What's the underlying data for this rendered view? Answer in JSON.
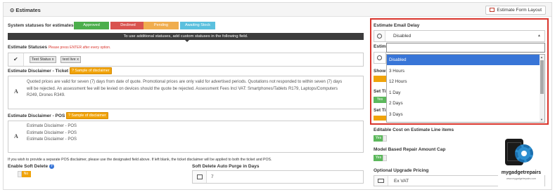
{
  "panel": {
    "title": "Estimates",
    "layout_button": "Estimate Form Layout"
  },
  "system_statuses": {
    "label": "System statuses for estimates:",
    "items": [
      {
        "label": "Approved",
        "color": "#5cb85c"
      },
      {
        "label": "Declined",
        "color": "#d9534f"
      },
      {
        "label": "Pending",
        "color": "#f0ad4e"
      },
      {
        "label": "Awaiting Stock",
        "color": "#5bc0de"
      }
    ],
    "hint": "To use additional statuses, add custom statuses in the following field."
  },
  "estimate_statuses": {
    "label": "Estimate Statuses",
    "note": "Please press ENTER after every option.",
    "tags": [
      "Test Status",
      "test live"
    ],
    "tag_close": "x"
  },
  "disclaimer_ticket": {
    "label": "Estimate Disclaimer - Ticket",
    "sample_button": "Sample of disclaimer",
    "lines": [
      "Quoted prices are valid for seven (7) days from date of quote. Promotional prices are only valid for advertised periods. Quotations not responded to within seven (7) days",
      "will be rejected. An assessment fee will be levied on devices should the quote be rejected. Assessment Fees Incl VAT: Smartphones/Tablets R179, Laptops/Computers",
      "R249, Drones R349."
    ]
  },
  "disclaimer_pos": {
    "label": "Estimate Disclaimer - POS",
    "sample_button": "Sample of disclaimer",
    "lines": [
      "Estimate Disclaimer - POS",
      "Estimate Disclaimer - POS",
      "Estimate Disclaimer - POS"
    ],
    "help": "If you wish to provide a separate POS disclaimer, please use the designated field above. If left blank, the ticket disclaimer will be applied to both the ticket and POS."
  },
  "soft_delete": {
    "label": "Enable Soft Delete",
    "toggle": "No"
  },
  "auto_purge": {
    "label": "Soft Delete Auto Purge in Days",
    "value": "7"
  },
  "email_delay": {
    "label": "Estimate Email Delay",
    "selected": "Disabled",
    "search_value": "",
    "options": [
      "Disabled",
      "3 Hours",
      "12 Hours",
      "1 Day",
      "2 Days",
      "3 Days"
    ]
  },
  "right_partial_labels": [
    "Estim",
    "Show",
    "Set Ti",
    "Set Ti"
  ],
  "right_partial_toggle": "Yes",
  "editable_cost": {
    "label": "Editable Cost on Estimate Line items",
    "toggle": "Yes"
  },
  "model_based": {
    "label": "Model Based Repair Amount Cap",
    "toggle": "Yes"
  },
  "upgrade_pricing": {
    "label": "Optional Upgrade Pricing",
    "value": "Ex VAT"
  },
  "logo": {
    "text": "mygadgetrepairs",
    "subtext": "www.mygadgetrepairs.com"
  }
}
